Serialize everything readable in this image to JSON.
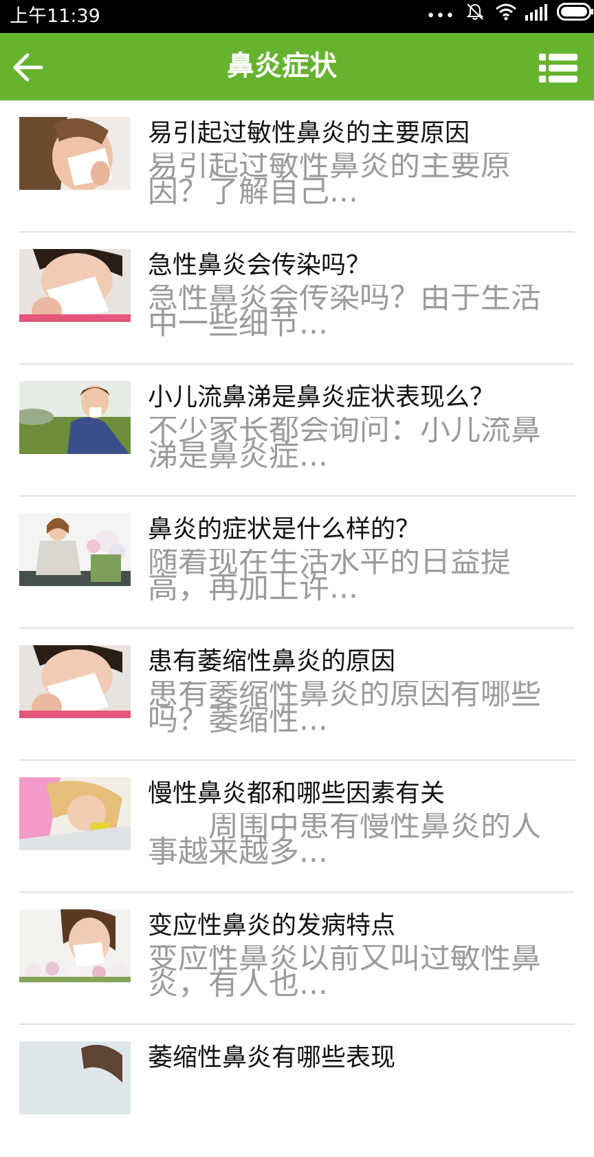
{
  "status_bar": {
    "time": "上午11:39",
    "dots": "•••",
    "icons": [
      "mute-icon",
      "wifi-icon",
      "signal-icon",
      "battery-icon"
    ]
  },
  "header": {
    "title": "鼻炎症状",
    "background_color": "#65b32e",
    "back_icon": "back-arrow-icon",
    "menu_icon": "list-menu-icon"
  },
  "articles": [
    {
      "title": "易引起过敏性鼻炎的主要原因",
      "summary": "易引起过敏性鼻炎的主要原因？了解自己..."
    },
    {
      "title": "急性鼻炎会传染吗？",
      "summary": "急性鼻炎会传染吗？由于生活中一些细节..."
    },
    {
      "title": "小儿流鼻涕是鼻炎症状表现么？",
      "summary": "不少家长都会询问：小儿流鼻涕是鼻炎症..."
    },
    {
      "title": "鼻炎的症状是什么样的？",
      "summary": "随着现在生活水平的日益提高，再加上许..."
    },
    {
      "title": "患有萎缩性鼻炎的原因",
      "summary": "患有萎缩性鼻炎的原因有哪些吗？萎缩性..."
    },
    {
      "title": "慢性鼻炎都和哪些因素有关",
      "summary": "　　周围中患有慢性鼻炎的人事越来越多..."
    },
    {
      "title": "变应性鼻炎的发病特点",
      "summary": "变应性鼻炎以前又叫过敏性鼻炎，有人也..."
    },
    {
      "title": "萎缩性鼻炎有哪些表现",
      "summary": ""
    }
  ]
}
